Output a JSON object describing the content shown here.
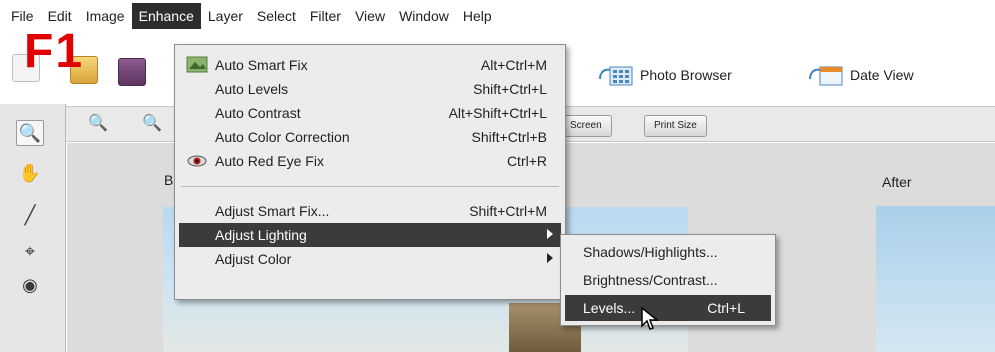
{
  "menubar": {
    "items": [
      "File",
      "Edit",
      "Image",
      "Enhance",
      "Layer",
      "Select",
      "Filter",
      "View",
      "Window",
      "Help"
    ],
    "active": "Enhance"
  },
  "toolbar": {
    "photo_browser": "Photo Browser",
    "date_view": "Date View"
  },
  "options": {
    "screen_label": "Screen",
    "print_size_label": "Print Size"
  },
  "canvas": {
    "before_label": "B",
    "after_label": "After"
  },
  "annotation": {
    "text": "F1",
    "color": "#e00000"
  },
  "enhance_menu": {
    "items": [
      {
        "label": "Auto Smart Fix",
        "shortcut": "Alt+Ctrl+M",
        "icon": "auto-smart-fix-icon"
      },
      {
        "label": "Auto Levels",
        "shortcut": "Shift+Ctrl+L"
      },
      {
        "label": "Auto Contrast",
        "shortcut": "Alt+Shift+Ctrl+L"
      },
      {
        "label": "Auto Color Correction",
        "shortcut": "Shift+Ctrl+B"
      },
      {
        "label": "Auto Red Eye Fix",
        "shortcut": "Ctrl+R",
        "icon": "red-eye-icon"
      },
      {
        "label": "Adjust Smart Fix...",
        "shortcut": "Shift+Ctrl+M"
      },
      {
        "label": "Adjust Lighting",
        "shortcut": "",
        "submenu": true,
        "highlighted": true
      },
      {
        "label": "Adjust Color",
        "shortcut": "",
        "submenu": true
      }
    ]
  },
  "lighting_submenu": {
    "items": [
      {
        "label": "Shadows/Highlights...",
        "shortcut": ""
      },
      {
        "label": "Brightness/Contrast...",
        "shortcut": ""
      },
      {
        "label": "Levels...",
        "shortcut": "Ctrl+L",
        "highlighted": true
      }
    ]
  },
  "colors": {
    "menu_highlight": "#3b3b3b",
    "menubar_active": "#2d2d2d"
  }
}
